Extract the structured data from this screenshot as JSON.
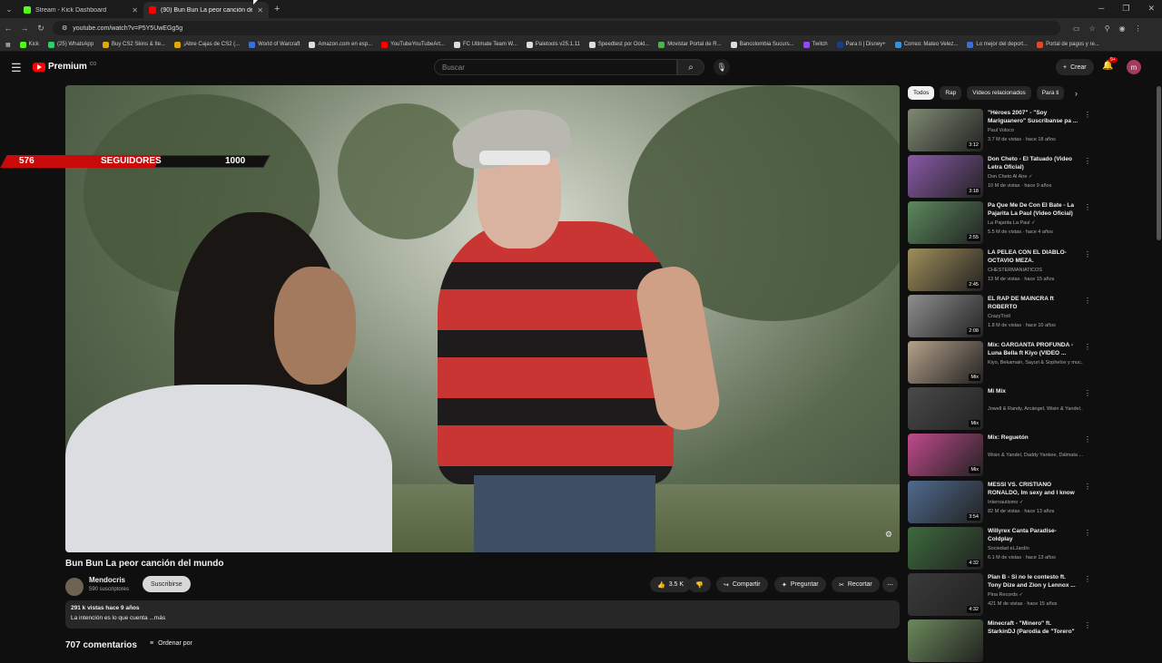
{
  "browser": {
    "tabs": [
      {
        "title": "Stream - Kick Dashboard",
        "color": "#53fc18",
        "active": false
      },
      {
        "title": "(90) Bun Bun La peor canción del mundo",
        "color": "#ff0000",
        "active": true
      }
    ],
    "url": "youtube.com/watch?v=P5Y5UwEGg5g",
    "bookmarks": [
      "Kick",
      "(25) WhatsApp",
      "Buy CS2 Skins & Ite...",
      "¡Abre Cajas de CS2 (...",
      "World of Warcraft",
      "Amazon.com en esp...",
      "YouTubeYouTubeArt...",
      "FC Ultimate Team W...",
      "Paletools v25.1.11",
      "Speedtest por Ookl...",
      "Movistar Portal de R...",
      "Bancolombia Sucurs...",
      "Twitch",
      "Para ti | Disney+",
      "Correo: Mateo Velez...",
      "Lo mejor del deport...",
      "Portal de pagos y re..."
    ]
  },
  "header": {
    "logo": "Premium",
    "country": "CO",
    "search_placeholder": "Buscar",
    "create": "Crear",
    "notif_badge": "9+",
    "avatar": "m"
  },
  "overlay": {
    "current": "576",
    "label": "SEGUIDORES",
    "goal": "1000"
  },
  "video": {
    "title": "Bun Bun La peor canción del mundo",
    "channel": "Mendocris",
    "subs": "590 suscriptores",
    "subscribe": "Suscribirse",
    "likes": "3.5 K",
    "share": "Compartir",
    "ask": "Preguntar",
    "clip": "Recortar",
    "views_date": "291 k vistas  hace 9 años",
    "description": "La intención es lo que cuenta  ...más",
    "comments": "707 comentarios",
    "sort": "Ordenar por"
  },
  "chips": [
    "Todos",
    "Rap",
    "Videos relacionados",
    "Para ti"
  ],
  "recommendations": [
    {
      "title": "\"Héroes 2007\" - \"Soy Mariguanero\" Suscribanse pa ...",
      "channel": "Paul Voloco",
      "meta": "3.7 M de vistas · hace 18 años",
      "dur": "3:12",
      "color": "#7f8a72"
    },
    {
      "title": "Don Cheto - El Tatuado (Video Letra Oficial)",
      "channel": "Don Cheto Al Aire ✓",
      "meta": "10 M de vistas · hace 9 años",
      "dur": "3:18",
      "color": "#8a5aa8"
    },
    {
      "title": "Pa Que Me De Con El Bate - La Pajarita La Paul (Video Oficial)",
      "channel": "La Pajarita La Paul ✓",
      "meta": "5.5 M de vistas · hace 4 años",
      "dur": "2:55",
      "color": "#5c8a5e"
    },
    {
      "title": "LA PELEA CON EL DIABLO- OCTAVIO MEZA.",
      "channel": "CHESTERMANIATICOS",
      "meta": "13 M de vistas · hace 15 años",
      "dur": "2:45",
      "color": "#a08e5a"
    },
    {
      "title": "EL RAP DE MAINCRA ft ROBERTO",
      "channel": "CrazyTroll",
      "meta": "1.8 M de vistas · hace 10 años",
      "dur": "2:08",
      "color": "#8f8f8f"
    },
    {
      "title": "Mix: GARGANTA PROFUNDA - Luna Bella ft Kiyo (VIDEO ...",
      "channel": "Kiyo, Bekamain, Sayuri & Sophelov y muc...",
      "meta": "",
      "dur": "Mix",
      "color": "#b3a18a"
    },
    {
      "title": "Mi Mix",
      "channel": "Jowell & Randy, Arcángel, Wisin & Yandel...",
      "meta": "",
      "dur": "Mix",
      "color": "#4a4a4a"
    },
    {
      "title": "Mix: Reguetón",
      "channel": "Wisin & Yandel, Daddy Yankee, Dálmata ...",
      "meta": "",
      "dur": "Mix",
      "color": "#c04a8c"
    },
    {
      "title": "MESSI VS. CRISTIANO RONALDO, Im sexy and I know ...",
      "channel": "Internautismo ✓",
      "meta": "82 M de vistas · hace 13 años",
      "dur": "3:54",
      "color": "#4f6a8e"
    },
    {
      "title": "Willyrex Canta Paradise- Coldplay",
      "channel": "Sociedad eLJardín",
      "meta": "6.1 M de vistas · hace 13 años",
      "dur": "4:32",
      "color": "#3d6b3d"
    },
    {
      "title": "Plan B - Si no le contesto ft. Tony Dize and Zion y Lennox ...",
      "channel": "Pina Records ✓",
      "meta": "421 M de vistas · hace 15 años",
      "dur": "4:32",
      "color": "#3a3a3a"
    },
    {
      "title": "Minecraft - \"Minero\" ft. StarkinDJ (Parodia de \"Torero\" ...",
      "channel": "",
      "meta": "",
      "dur": "",
      "color": "#6b8a5a"
    }
  ]
}
